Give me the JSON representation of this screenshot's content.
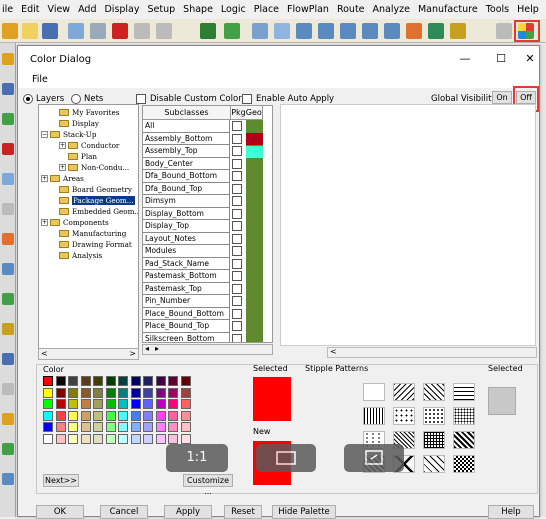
{
  "app_menu": [
    "ile",
    "Edit",
    "View",
    "Add",
    "Display",
    "Setup",
    "Shape",
    "Logic",
    "Place",
    "FlowPlan",
    "Route",
    "Analyze",
    "Manufacture",
    "Tools",
    "Help"
  ],
  "dialog": {
    "title": "Color Dialog",
    "window_controls": {
      "minimize": "—",
      "maximize": "☐",
      "close": "✕"
    },
    "menu_file": "File",
    "options": {
      "layers": "Layers",
      "nets": "Nets",
      "disable_custom": "Disable Custom Colors",
      "enable_autoapply": "Enable Auto Apply",
      "global_visibility": "Global Visibility:",
      "on": "On",
      "off": "Off"
    },
    "tree": [
      {
        "label": "My Favorites",
        "level": 1,
        "exp": ""
      },
      {
        "label": "Display",
        "level": 1,
        "exp": ""
      },
      {
        "label": "Stack-Up",
        "level": 0,
        "exp": "−"
      },
      {
        "label": "Conductor",
        "level": 2,
        "exp": "+"
      },
      {
        "label": "Plan",
        "level": 2,
        "exp": ""
      },
      {
        "label": "Non-Condu...",
        "level": 2,
        "exp": "+"
      },
      {
        "label": "Areas",
        "level": 0,
        "exp": "+"
      },
      {
        "label": "Board Geometry",
        "level": 1,
        "exp": ""
      },
      {
        "label": "Package Geom...",
        "level": 1,
        "exp": "",
        "selected": true
      },
      {
        "label": "Embedded Geom...",
        "level": 1,
        "exp": ""
      },
      {
        "label": "Components",
        "level": 0,
        "exp": "+"
      },
      {
        "label": "Manufacturing",
        "level": 1,
        "exp": ""
      },
      {
        "label": "Drawing Format",
        "level": 1,
        "exp": ""
      },
      {
        "label": "Analysis",
        "level": 1,
        "exp": ""
      }
    ],
    "grid": {
      "col_subclasses": "Subclasses",
      "col_pkggeo": "PkgGeo",
      "rows": [
        "All",
        "Assembly_Bottom",
        "Assembly_Top",
        "Body_Center",
        "Dfa_Bound_Bottom",
        "Dfa_Bound_Top",
        "Dimsym",
        "Display_Bottom",
        "Display_Top",
        "Layout_Notes",
        "Modules",
        "Pad_Stack_Name",
        "Pastemask_Bottom",
        "Pastemask_Top",
        "Pin_Number",
        "Place_Bound_Bottom",
        "Place_Bound_Top",
        "Silkscreen_Bottom"
      ]
    },
    "color_section": {
      "color_label": "Color",
      "selected_label": "Selected",
      "new_label": "New",
      "stipple_label": "Stipple Patterns",
      "stipple_selected_label": "Selected",
      "next_button": "Next>>",
      "customize_button": "Customize ...",
      "selected_color": "#ff0000",
      "new_color": "#ff0000"
    },
    "buttons": {
      "ok": "OK",
      "cancel": "Cancel",
      "apply": "Apply",
      "reset": "Reset",
      "hide_palette": "Hide Palette",
      "help": "Help"
    },
    "overlay_buttons": {
      "one_to_one": "1:1"
    }
  },
  "palette": [
    [
      "#ff0000",
      "#000000",
      "#404040",
      "#5a3b1e",
      "#404000",
      "#004000",
      "#004040",
      "#000060",
      "#202060",
      "#400040",
      "#600030",
      "#600000"
    ],
    [
      "#ffff00",
      "#800000",
      "#808000",
      "#8b5a2b",
      "#808040",
      "#008000",
      "#008080",
      "#0000a0",
      "#4040a0",
      "#800080",
      "#a00060",
      "#a04040"
    ],
    [
      "#00ff00",
      "#c00000",
      "#c0c000",
      "#c08040",
      "#a0a060",
      "#00c000",
      "#00c0c0",
      "#0000ff",
      "#6060ff",
      "#c000c0",
      "#ff0080",
      "#ff6060"
    ],
    [
      "#00ffff",
      "#ff4040",
      "#ffff40",
      "#d0a060",
      "#c0c080",
      "#40ff40",
      "#40ffff",
      "#4080ff",
      "#8080ff",
      "#ff40ff",
      "#ff60a0",
      "#ff9090"
    ],
    [
      "#0000ff",
      "#ff8080",
      "#ffff80",
      "#e0c090",
      "#d0d0a0",
      "#80ff80",
      "#80ffff",
      "#80b0ff",
      "#a0a0ff",
      "#ff80ff",
      "#ff90c0",
      "#ffc0c0"
    ],
    [
      "#ffffff",
      "#ffc0c0",
      "#ffffc0",
      "#f0e0c0",
      "#e0e0c0",
      "#c0ffc0",
      "#c0ffff",
      "#c0d8ff",
      "#d0d0ff",
      "#ffc0ff",
      "#ffc0e0",
      "#ffe0e0"
    ]
  ],
  "colors": {
    "selected_tree": "#0b3a8a",
    "geo_column": "#5f8a2e",
    "assembly_bottom": "#b0001a",
    "assembly_top": "#3dffd8",
    "highlight": "#e53935"
  }
}
